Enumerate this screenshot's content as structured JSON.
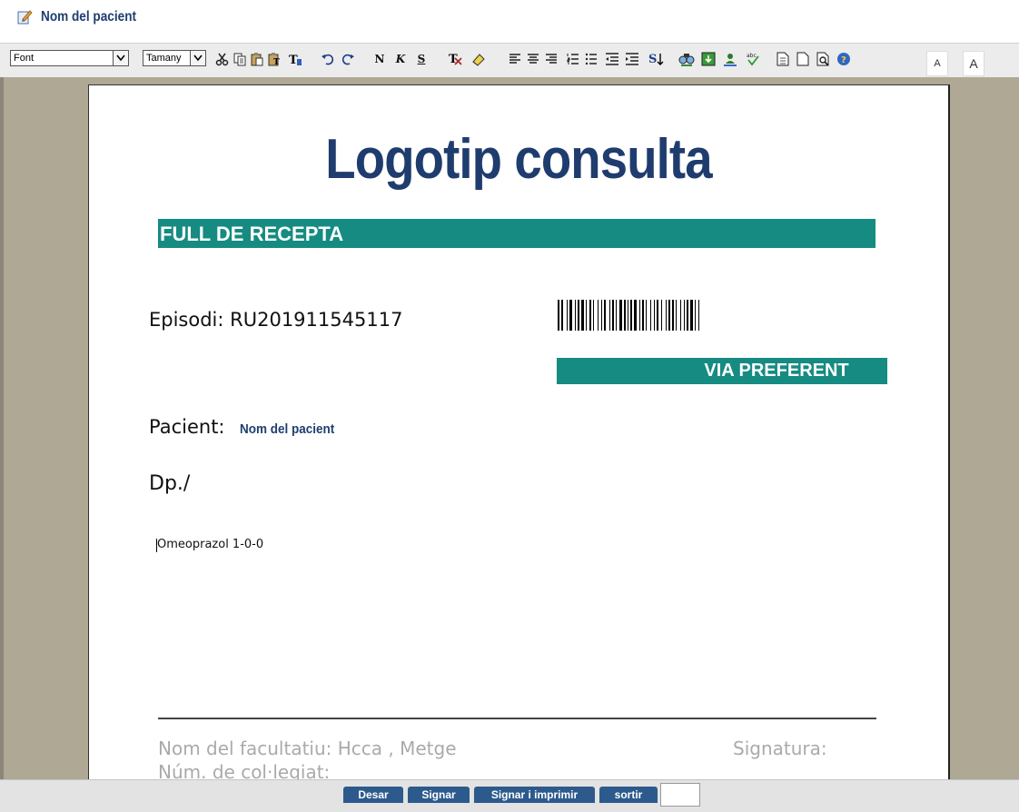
{
  "window": {
    "title": "Nom del pacient"
  },
  "toolbar": {
    "font_select": "Font",
    "size_select": "Tamany",
    "bold_label": "N",
    "italic_label": "K",
    "underline_label": "S",
    "sort_label": "S",
    "font_decrease_label": "A",
    "font_increase_label": "A"
  },
  "document": {
    "logo_text": "Logotip consulta",
    "header_band": "FULL DE RECEPTA",
    "episodi_label": "Episodi: RU201911545117",
    "via_band": "VIA PREFERENT",
    "pacient_label": "Pacient:",
    "pacient_value": "Nom del pacient",
    "dp_label": "Dp./",
    "prescription": "Omeoprazol 1-0-0",
    "facultatiu": "Nom del facultatiu: Hcca , Metge",
    "signatura": "Signatura:",
    "colegiat": "Núm. de col·legiat:"
  },
  "actions": {
    "desar": "Desar",
    "signar": "Signar",
    "signar_imprimir": "Signar i imprimir",
    "sortir": "sortir"
  },
  "colors": {
    "band": "#168b82",
    "logo": "#1f3c6e",
    "button": "#2d5a8c"
  }
}
